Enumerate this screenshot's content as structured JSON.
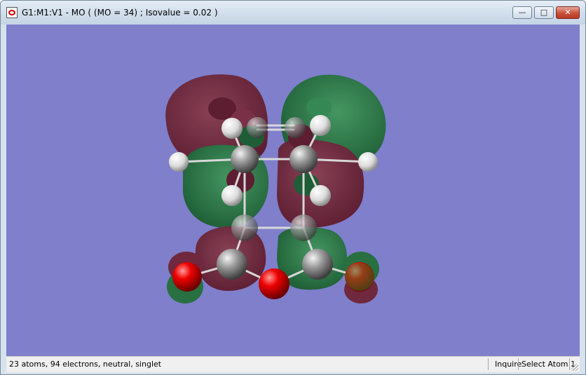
{
  "window": {
    "title": "G1:M1:V1 - MO ( (MO = 34) ; Isovalue = 0.02 )",
    "controls": {
      "minimize_icon": "minimize-icon",
      "maximize_icon": "maximize-icon",
      "close_icon": "close-icon"
    }
  },
  "viewport": {
    "background_color": "#7f7fcc",
    "orbital_colors": {
      "positive": "#6e1f2e",
      "negative": "#1f6e32"
    },
    "atom_colors": {
      "carbon": "#8a8a8a",
      "hydrogen": "#eeeeee",
      "oxygen": "#e00000"
    }
  },
  "status": {
    "info": "23 atoms, 94 electrons, neutral, singlet",
    "mode": "Inquire",
    "action": "Select Atom 1"
  }
}
